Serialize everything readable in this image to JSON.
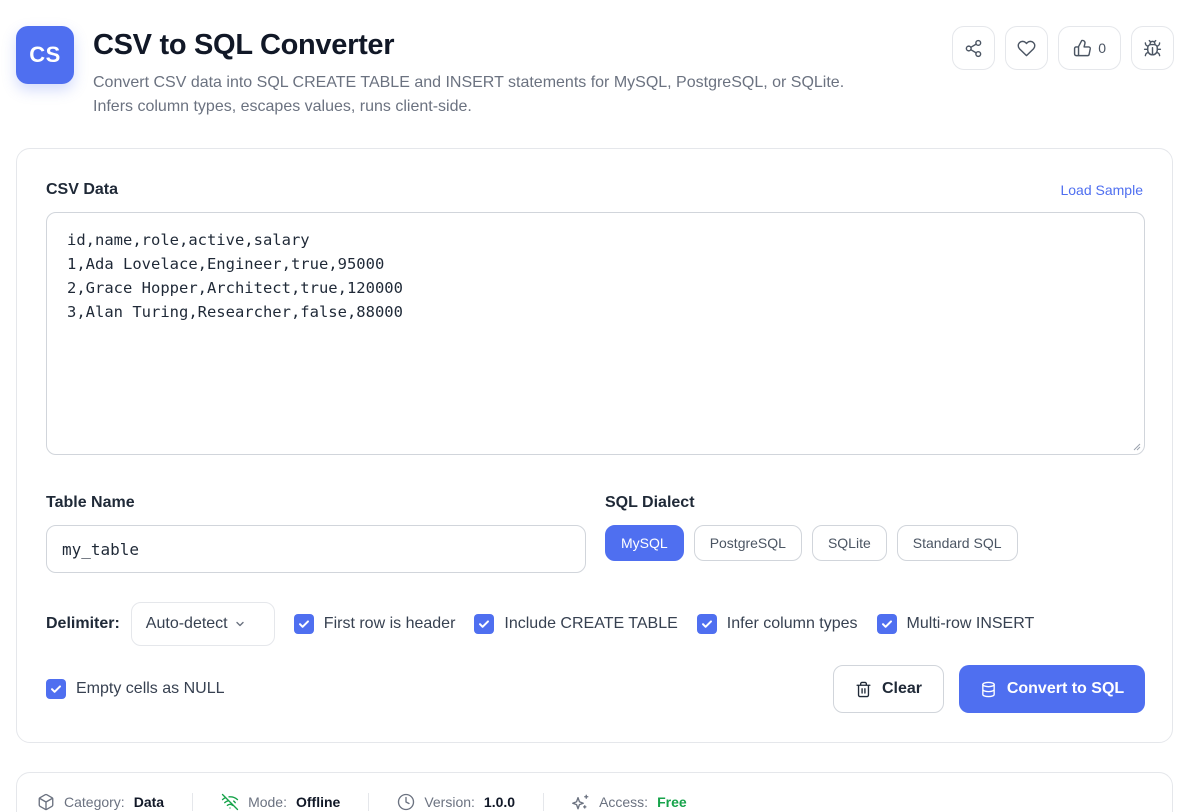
{
  "header": {
    "logo_text": "CS",
    "title": "CSV to SQL Converter",
    "description_line1": "Convert CSV data into SQL CREATE TABLE and INSERT statements for MySQL, PostgreSQL, or SQLite.",
    "description_line2": "Infers column types, escapes values, runs client-side.",
    "like_count": "0",
    "accent_color": "#4f6ff0"
  },
  "csv": {
    "label": "CSV Data",
    "load_sample": "Load Sample",
    "lines": [
      "id,name,role,active,salary",
      "1,Ada Lovelace,Engineer,true,95000",
      "2,Grace Hopper,Architect,true,120000",
      "3,Alan Turing,Researcher,false,88000"
    ]
  },
  "table": {
    "label": "Table Name",
    "value": "my_table"
  },
  "dialect": {
    "label": "SQL Dialect",
    "options": [
      "MySQL",
      "PostgreSQL",
      "SQLite",
      "Standard SQL"
    ],
    "selected": "MySQL"
  },
  "options": {
    "delimiter_label": "Delimiter:",
    "delimiter_value": "Auto-detect",
    "first_row_header": "First row is header",
    "include_create": "Include CREATE TABLE",
    "infer_types": "Infer column types",
    "multi_row": "Multi-row INSERT",
    "empty_null": "Empty cells as NULL"
  },
  "actions": {
    "clear": "Clear",
    "convert": "Convert to SQL"
  },
  "info": {
    "category_label": "Category:",
    "category_value": "Data",
    "mode_label": "Mode:",
    "mode_value": "Offline",
    "version_label": "Version:",
    "version_value": "1.0.0",
    "access_label": "Access:",
    "access_value": "Free"
  }
}
